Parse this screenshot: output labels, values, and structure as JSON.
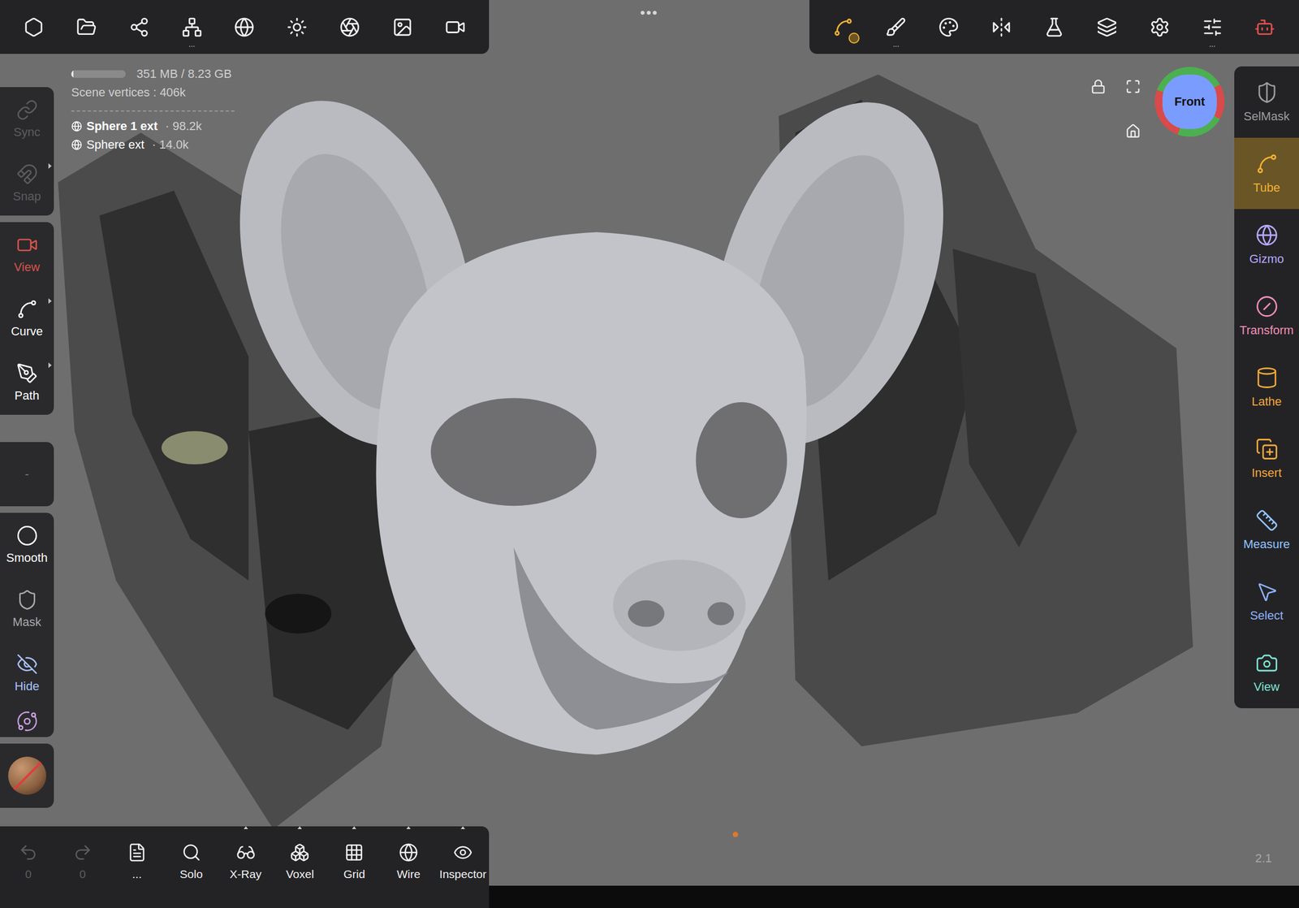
{
  "top_left_toolbar": [
    {
      "more": ""
    },
    {
      "more": ""
    },
    {
      "more": ""
    },
    {
      "more": "..."
    },
    {
      "more": ""
    },
    {
      "more": ""
    },
    {
      "more": ""
    },
    {
      "more": ""
    },
    {
      "more": ""
    }
  ],
  "handle": "•••",
  "top_right_toolbar": [
    {
      "selected": true,
      "badge": true,
      "more": ""
    },
    {
      "selected": false,
      "badge": false,
      "more": "..."
    },
    {
      "selected": false,
      "badge": false,
      "more": ""
    },
    {
      "selected": false,
      "badge": false,
      "more": ""
    },
    {
      "selected": false,
      "badge": false,
      "more": ""
    },
    {
      "selected": false,
      "badge": false,
      "more": ""
    },
    {
      "selected": false,
      "badge": false,
      "more": ""
    },
    {
      "selected": false,
      "badge": false,
      "more": "..."
    },
    {
      "selected": false,
      "badge": false,
      "more": ""
    }
  ],
  "info": {
    "memory": "351 MB / 8.23 GB",
    "memory_level": 0.04,
    "vertices": "Scene vertices : 406k",
    "objects": [
      {
        "name": "Sphere 1 ext",
        "count": "· 98.2k",
        "selected": true
      },
      {
        "name": "Sphere ext",
        "count": "· 14.0k",
        "selected": false
      }
    ]
  },
  "view_cube": {
    "label": "Front"
  },
  "left_sidebar": [
    [
      {
        "kind": "tool",
        "label": "Sync",
        "disabled": true,
        "submenu": false,
        "color": "#5c5c5e"
      },
      {
        "kind": "tool",
        "label": "Snap",
        "disabled": true,
        "submenu": true,
        "color": "#5c5c5e"
      }
    ],
    [
      {
        "kind": "tool",
        "label": "View",
        "disabled": false,
        "submenu": false,
        "color": "#d9534f"
      },
      {
        "kind": "tool",
        "label": "Curve",
        "disabled": false,
        "submenu": true,
        "color": "#ffffff"
      },
      {
        "kind": "tool",
        "label": "Path",
        "disabled": false,
        "submenu": true,
        "color": "#ffffff"
      }
    ],
    [
      {
        "kind": "note",
        "label": "-",
        "disabled": false,
        "submenu": false,
        "color": "#7a7a7c"
      }
    ],
    [
      {
        "kind": "tool",
        "label": "Smooth",
        "disabled": false,
        "submenu": false,
        "color": "#ffffff"
      },
      {
        "kind": "tool",
        "label": "Mask",
        "disabled": false,
        "submenu": false,
        "color": "#a9a9ab"
      },
      {
        "kind": "tool",
        "label": "Hide",
        "disabled": false,
        "submenu": false,
        "color": "#a9c4ff"
      },
      {
        "kind": "icon",
        "label": "",
        "disabled": false,
        "submenu": false,
        "color": "#c9a0e0"
      }
    ],
    [
      {
        "kind": "material",
        "label": "",
        "disabled": true,
        "submenu": false,
        "color": "#8a6040"
      }
    ]
  ],
  "right_sidebar": [
    {
      "label": "SelMask",
      "selected": false,
      "color": "#9c9c9e"
    },
    {
      "label": "Tube",
      "selected": true,
      "color": "#f2b233"
    },
    {
      "label": "Gizmo",
      "selected": false,
      "color": "#b8a8ff"
    },
    {
      "label": "Transform",
      "selected": false,
      "color": "#f48fb8"
    },
    {
      "label": "Lathe",
      "selected": false,
      "color": "#f5a83a"
    },
    {
      "label": "Insert",
      "selected": false,
      "color": "#f5a83a"
    },
    {
      "label": "Measure",
      "selected": false,
      "color": "#93c6ff"
    },
    {
      "label": "Select",
      "selected": false,
      "color": "#8fb2ff"
    },
    {
      "label": "View",
      "selected": false,
      "color": "#7fe3d3"
    }
  ],
  "bottom_toolbar": [
    {
      "label": "0",
      "disabled": true,
      "options": false
    },
    {
      "label": "0",
      "disabled": true,
      "options": false
    },
    {
      "label": "...",
      "disabled": false,
      "options": false
    },
    {
      "label": "Solo",
      "disabled": false,
      "options": false
    },
    {
      "label": "X-Ray",
      "disabled": false,
      "options": true
    },
    {
      "label": "Voxel",
      "disabled": false,
      "options": true
    },
    {
      "label": "Grid",
      "disabled": false,
      "options": true
    },
    {
      "label": "Wire",
      "disabled": false,
      "options": true
    },
    {
      "label": "Inspector",
      "disabled": false,
      "options": true
    }
  ],
  "version": "2.1"
}
